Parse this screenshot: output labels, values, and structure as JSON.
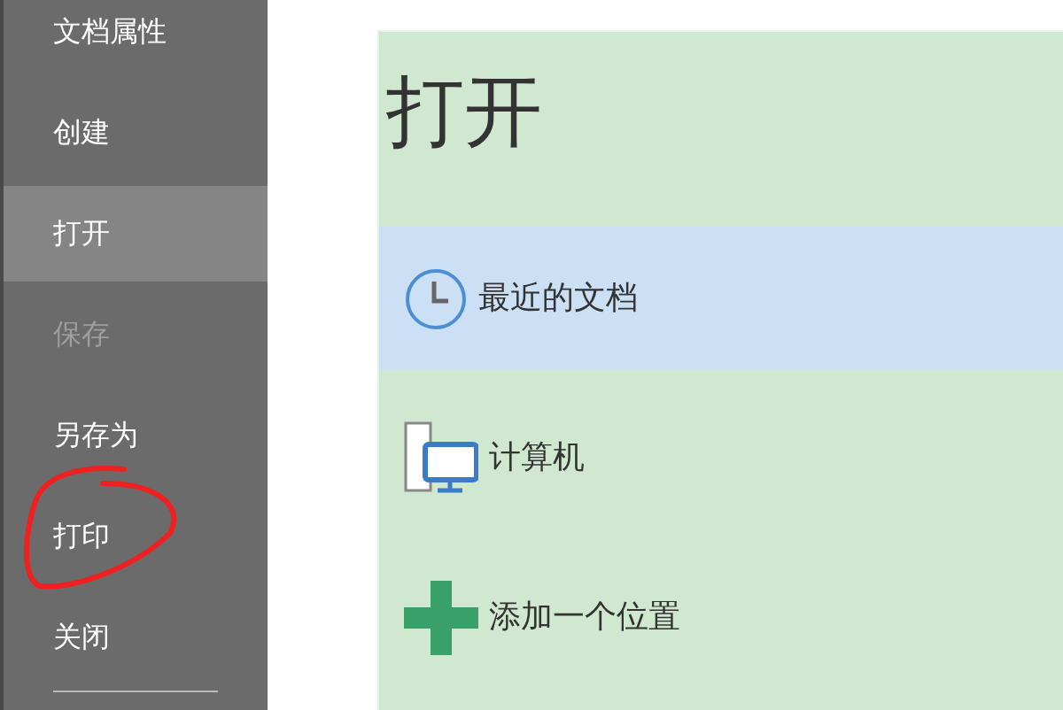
{
  "sidebar": {
    "items": [
      {
        "label": "文档属性",
        "selected": false,
        "disabled": false,
        "circled": false
      },
      {
        "label": "创建",
        "selected": false,
        "disabled": false,
        "circled": false
      },
      {
        "label": "打开",
        "selected": true,
        "disabled": false,
        "circled": false
      },
      {
        "label": "保存",
        "selected": false,
        "disabled": true,
        "circled": false
      },
      {
        "label": "另存为",
        "selected": false,
        "disabled": false,
        "circled": false
      },
      {
        "label": "打印",
        "selected": false,
        "disabled": false,
        "circled": true
      },
      {
        "label": "关闭",
        "selected": false,
        "disabled": false,
        "circled": false
      }
    ]
  },
  "panel": {
    "title": "打开",
    "locations": [
      {
        "kind": "recent",
        "label": "最近的文档",
        "selected": true
      },
      {
        "kind": "computer",
        "label": "计算机",
        "selected": false
      },
      {
        "kind": "add",
        "label": "添加一个位置",
        "selected": false
      }
    ]
  }
}
